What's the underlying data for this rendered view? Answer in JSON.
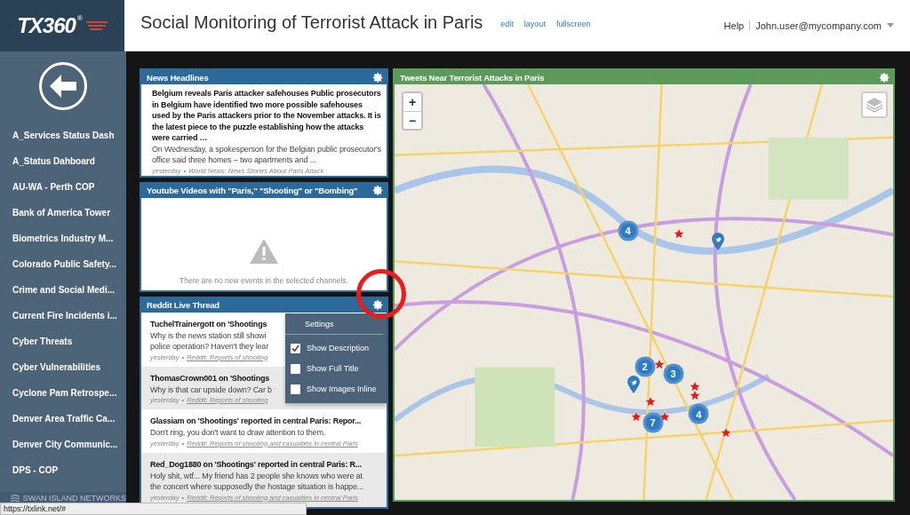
{
  "header": {
    "logo": "TX360",
    "logo_mark": "®",
    "title": "Social Monitoring of Terrorist Attack in Paris",
    "links": [
      "edit",
      "layout",
      "fullscreen"
    ],
    "help": "Help",
    "user": "John.user@mycompany.com"
  },
  "sidebar": {
    "items": [
      {
        "label": "A_Services Status Dash"
      },
      {
        "label": "A_Status Dahboard"
      },
      {
        "label": "AU-WA - Perth COP"
      },
      {
        "label": "Bank of America Tower"
      },
      {
        "label": "Biometrics Industry M..."
      },
      {
        "label": "Colorado Public Safety..."
      },
      {
        "label": "Crime and Social Medi..."
      },
      {
        "label": "Current Fire Incidents i..."
      },
      {
        "label": "Cyber Threats"
      },
      {
        "label": "Cyber Vulnerabilities"
      },
      {
        "label": "Cyclone Pam Retrospe..."
      },
      {
        "label": "Denver Area Traffic Ca..."
      },
      {
        "label": "Denver City Communic..."
      },
      {
        "label": "DPS - COP"
      }
    ],
    "footer": "SWAN ISLAND NETWORKS"
  },
  "news": {
    "title": "News Headlines",
    "items": [
      {
        "headline": "Belgium reveals Paris attacker safehouses Public prosecutors in Belgium have identified two more possible safehouses used by the Paris attackers prior to the November attacks. It is the latest piece to the puzzle establishing how the attacks were carried …",
        "description": "On Wednesday, a spokesperson for the Belgian public prosecutor's office said three homes – two apartments and ...",
        "time": "yesterday",
        "separator": "•",
        "source": "World News: News Stories About Paris Attack"
      }
    ]
  },
  "youtube": {
    "title": "Youtube Videos with \"Paris,\" \"Shooting\" or \"Bombing\"",
    "empty_message": "There are no new events in the selected channels."
  },
  "reddit": {
    "title": "Reddit Live Thread",
    "items": [
      {
        "title": "TuchelTrainergott on 'Shootings",
        "description": [
          "Why is the news station still showi",
          "police operation? Haven't they lear"
        ],
        "time": "yesterday",
        "separator": "•",
        "source": "Reddit: Reports of shooting"
      },
      {
        "title": "ThomasCrown001 on 'Shootings",
        "description": [
          "Why is that car upside down? Car b"
        ],
        "time": "yesterday",
        "separator": "•",
        "source": "Reddit: Reports of shooting"
      },
      {
        "title": "Glassiam on 'Shootings' reported in central Paris: Repor...",
        "description": [
          "Don't ring, you don't want to draw attention to them."
        ],
        "time": "yesterday",
        "separator": "•",
        "source": "Reddit: Reports of shooting and casualties in central Paris"
      },
      {
        "title": "Red_Dog1880 on 'Shootings' reported in central Paris: R...",
        "description": [
          "Holy shit, wtf... My friend has 2 people she knows who were at",
          "the concert where supposedly the hostage situation is happe..."
        ],
        "time": "yesterday",
        "separator": "•",
        "source": "Reddit: Reports of shooting and casualties in central Paris"
      }
    ],
    "menu": {
      "title": "Settings",
      "options": [
        {
          "label": "Show Description",
          "checked": true
        },
        {
          "label": "Show Full Title",
          "checked": false
        },
        {
          "label": "Show Images Inline",
          "checked": false
        }
      ]
    }
  },
  "map": {
    "title": "Tweets Near Terrorist Attacks in Paris",
    "zoom_in": "+",
    "zoom_out": "−",
    "markers": [
      {
        "kind": "cluster",
        "count": "4"
      },
      {
        "kind": "star"
      },
      {
        "kind": "tweet"
      },
      {
        "kind": "cluster",
        "count": "2"
      },
      {
        "kind": "star"
      },
      {
        "kind": "cluster",
        "count": "3"
      },
      {
        "kind": "tweet"
      },
      {
        "kind": "star"
      },
      {
        "kind": "star"
      },
      {
        "kind": "cluster",
        "count": "4"
      },
      {
        "kind": "star"
      },
      {
        "kind": "star"
      },
      {
        "kind": "star"
      },
      {
        "kind": "cluster",
        "count": "7"
      },
      {
        "kind": "star"
      }
    ]
  },
  "status_bar": {
    "url": "https://txlink.net/#"
  }
}
